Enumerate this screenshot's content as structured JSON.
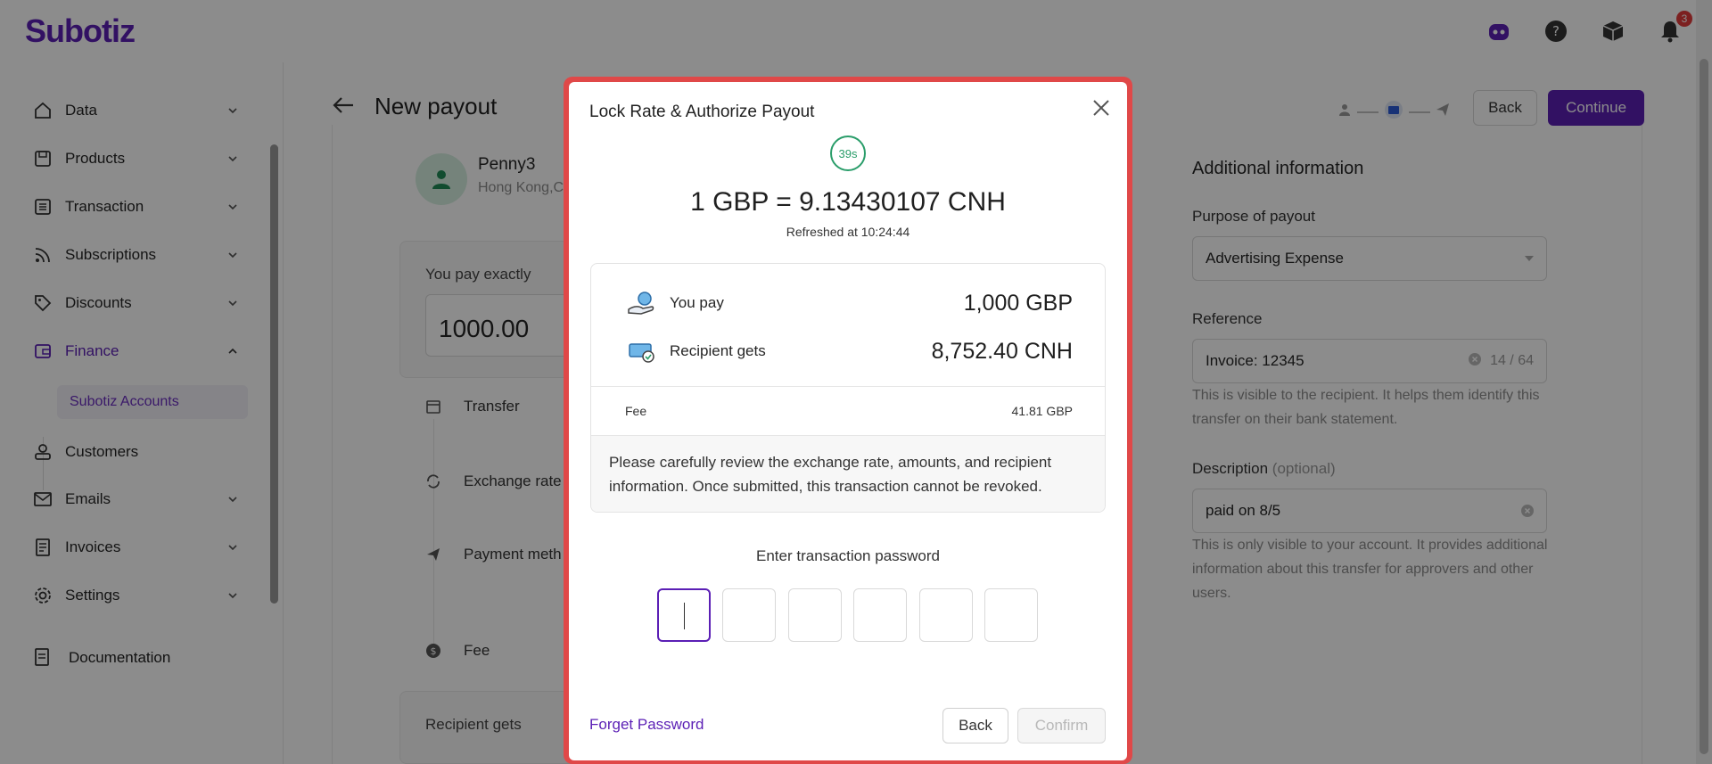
{
  "app": {
    "logo": "Subotiz",
    "notifications_count": "3",
    "icons": [
      "assistant-bot-icon",
      "help-icon",
      "package-icon",
      "bell-icon"
    ]
  },
  "sidebar": {
    "items": [
      {
        "label": "Data",
        "icon": "home-icon"
      },
      {
        "label": "Products",
        "icon": "box-icon"
      },
      {
        "label": "Transaction",
        "icon": "list-icon"
      },
      {
        "label": "Subscriptions",
        "icon": "rss-icon"
      },
      {
        "label": "Discounts",
        "icon": "tag-icon"
      },
      {
        "label": "Finance",
        "icon": "wallet-icon"
      },
      {
        "label": "Customers",
        "icon": "user-icon"
      },
      {
        "label": "Emails",
        "icon": "mail-icon"
      },
      {
        "label": "Invoices",
        "icon": "invoice-icon"
      },
      {
        "label": "Settings",
        "icon": "gear-icon"
      }
    ],
    "active_sub": "Subotiz Accounts",
    "documentation": "Documentation"
  },
  "page": {
    "title": "New payout",
    "back_label": "Back",
    "continue_label": "Continue",
    "payee_name": "Penny3",
    "payee_location": "Hong Kong,C",
    "you_pay_label": "You pay exactly",
    "you_pay_value": "1000.00",
    "timeline": [
      "Transfer",
      "Exchange rate",
      "Payment meth",
      "Fee"
    ],
    "recipient_gets_label": "Recipient gets"
  },
  "additional": {
    "title": "Additional information",
    "purpose_label": "Purpose of payout",
    "purpose_value": "Advertising Expense",
    "reference_label": "Reference",
    "reference_value": "Invoice: 12345",
    "reference_count": "14 / 64",
    "reference_help": "This is visible to the recipient. It helps them identify this transfer on their bank statement.",
    "description_label": "Description",
    "description_optional": "(optional)",
    "description_value": "paid on 8/5",
    "description_help": "This is only visible to your account. It provides additional information about this transfer for approvers and other users."
  },
  "modal": {
    "title": "Lock Rate & Authorize Payout",
    "countdown": "39s",
    "rate": "1 GBP = 9.13430107 CNH",
    "refreshed": "Refreshed at 10:24:44",
    "you_pay_label": "You pay",
    "you_pay_value": "1,000 GBP",
    "recipient_label": "Recipient gets",
    "recipient_value": "8,752.40 CNH",
    "fee_label": "Fee",
    "fee_value": "41.81 GBP",
    "notice": "Please carefully review the exchange rate, amounts, and recipient information. Once submitted, this transaction cannot be revoked.",
    "password_label": "Enter transaction password",
    "forget_label": "Forget Password",
    "back_label": "Back",
    "confirm_label": "Confirm"
  },
  "colors": {
    "brand": "#5b1fb5",
    "highlight_border": "#e04848",
    "countdown": "#2a9d6a"
  }
}
